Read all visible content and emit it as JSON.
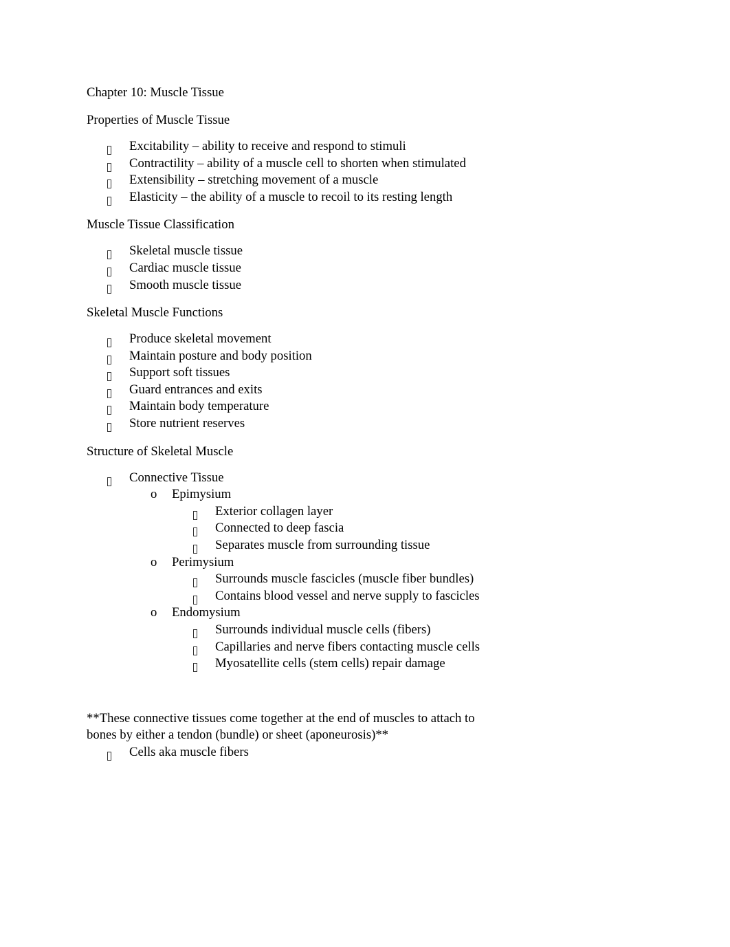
{
  "document": {
    "title": "Chapter 10: Muscle Tissue",
    "bullet_icon": "missing-glyph-box",
    "sub_bullet_glyph": "o",
    "sections": [
      {
        "heading": "Properties of Muscle Tissue",
        "items": [
          {
            "text": "Excitability – ability to receive and respond to stimuli"
          },
          {
            "text": "Contractility – ability of a muscle cell to shorten when stimulated"
          },
          {
            "text": "Extensibility – stretching movement of a muscle"
          },
          {
            "text": "Elasticity – the ability of a muscle to recoil to its resting length"
          }
        ]
      },
      {
        "heading": "Muscle Tissue Classification",
        "items": [
          {
            "text": "Skeletal muscle tissue"
          },
          {
            "text": "Cardiac muscle tissue"
          },
          {
            "text": "Smooth muscle tissue"
          }
        ]
      },
      {
        "heading": "Skeletal Muscle Functions",
        "items": [
          {
            "text": "Produce skeletal movement"
          },
          {
            "text": "Maintain posture and body position"
          },
          {
            "text": "Support soft tissues"
          },
          {
            "text": "Guard entrances and exits"
          },
          {
            "text": "Maintain body temperature"
          },
          {
            "text": "Store nutrient reserves"
          }
        ]
      },
      {
        "heading": "Structure of Skeletal Muscle",
        "items": [
          {
            "text": "Connective Tissue",
            "children": [
              {
                "text": "Epimysium",
                "children": [
                  {
                    "text": "Exterior collagen layer"
                  },
                  {
                    "text": "Connected to deep fascia"
                  },
                  {
                    "text": "Separates muscle from surrounding tissue"
                  }
                ]
              },
              {
                "text": "Perimysium",
                "children": [
                  {
                    "text": "Surrounds muscle fascicles (muscle fiber bundles)"
                  },
                  {
                    "text": "Contains blood vessel and nerve supply to fascicles"
                  }
                ]
              },
              {
                "text": "Endomysium",
                "children": [
                  {
                    "text": "Surrounds individual muscle cells (fibers)"
                  },
                  {
                    "text": "Capillaries and nerve fibers contacting muscle cells"
                  },
                  {
                    "text": "Myosatellite cells (stem cells) repair damage"
                  }
                ]
              }
            ]
          }
        ],
        "note": "**These connective tissues come together at the end of muscles to attach to bones by either a tendon (bundle) or sheet (aponeurosis)**",
        "trailing_items": [
          {
            "text": "Cells aka muscle fibers"
          }
        ]
      }
    ]
  }
}
